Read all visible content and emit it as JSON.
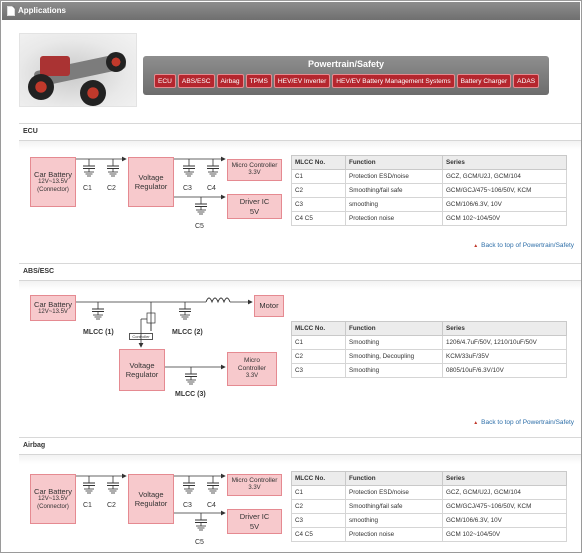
{
  "window": {
    "title": "Applications"
  },
  "powertrain": {
    "title": "Powertrain/Safety",
    "tabs": [
      "ECU",
      "ABS/ESC",
      "Airbag",
      "TPMS",
      "HEV/EV Inverter",
      "HEV/EV Battery Management Systems",
      "Battery Charger",
      "ADAS"
    ]
  },
  "back_link": "Back to top of Powertrain/Safety",
  "table_headers": {
    "no": "MLCC No.",
    "function": "Function",
    "series": "Series"
  },
  "ecu": {
    "heading": "ECU",
    "battery": [
      "Car Battery",
      "12V~13.5V",
      "(Connector)"
    ],
    "regulator": [
      "Voltage",
      "Regulator"
    ],
    "micro": [
      "Micro Controller",
      "3.3V"
    ],
    "driver": [
      "Driver IC",
      "5V"
    ],
    "caps": [
      "C1",
      "C2",
      "C3",
      "C4",
      "C5"
    ],
    "rows": [
      {
        "no": "C1",
        "function": "Protection ESD/noise",
        "series": "GCZ, GCM/U2J, GCM/104"
      },
      {
        "no": "C2",
        "function": "Smoothing/fail safe",
        "series": "GCM/GCJ/475~106/50V, KCM"
      },
      {
        "no": "C3",
        "function": "smoothing",
        "series": "GCM/106/6.3V, 10V"
      },
      {
        "no": "C4 C5",
        "function": "Protection noise",
        "series": "GCM 102~104/50V"
      }
    ]
  },
  "abs": {
    "heading": "ABS/ESC",
    "battery": [
      "Car Battery",
      "12V~13.5V"
    ],
    "motor": "Motor",
    "controller": "Controller",
    "regulator": [
      "Voltage",
      "Regulator"
    ],
    "micro": [
      "Micro",
      "Controller",
      "3.3V"
    ],
    "caps": [
      "MLCC (1)",
      "MLCC (2)",
      "MLCC (3)"
    ],
    "rows": [
      {
        "no": "C1",
        "function": "Smoothing",
        "series": "1206/4.7uF/50V, 1210/10uF/50V"
      },
      {
        "no": "C2",
        "function": "Smoothing, Decoupling",
        "series": "KCM/33uF/35V"
      },
      {
        "no": "C3",
        "function": "Smoothing",
        "series": "0805/10uF/6.3V/10V"
      }
    ]
  },
  "airbag": {
    "heading": "Airbag",
    "battery": [
      "Car Battery",
      "12V~13.5V",
      "(Connector)"
    ],
    "regulator": [
      "Voltage",
      "Regulator"
    ],
    "micro": [
      "Micro Controller",
      "3.3V"
    ],
    "driver": [
      "Driver IC",
      "5V"
    ],
    "caps": [
      "C1",
      "C2",
      "C3",
      "C4",
      "C5"
    ],
    "rows": [
      {
        "no": "C1",
        "function": "Protection ESD/noise",
        "series": "GCZ, GCM/U2J, GCM/104"
      },
      {
        "no": "C2",
        "function": "Smoothing/fail safe",
        "series": "GCM/GCJ/475~106/50V, KCM"
      },
      {
        "no": "C3",
        "function": "smoothing",
        "series": "GCM/106/6.3V, 10V"
      },
      {
        "no": "C4 C5",
        "function": "Protection noise",
        "series": "GCM 102~104/50V"
      }
    ]
  },
  "colors": {
    "accent": "#b5262e",
    "block_fill": "#f7c9cc",
    "block_border": "#e58a91",
    "link": "#2d6ea8"
  }
}
